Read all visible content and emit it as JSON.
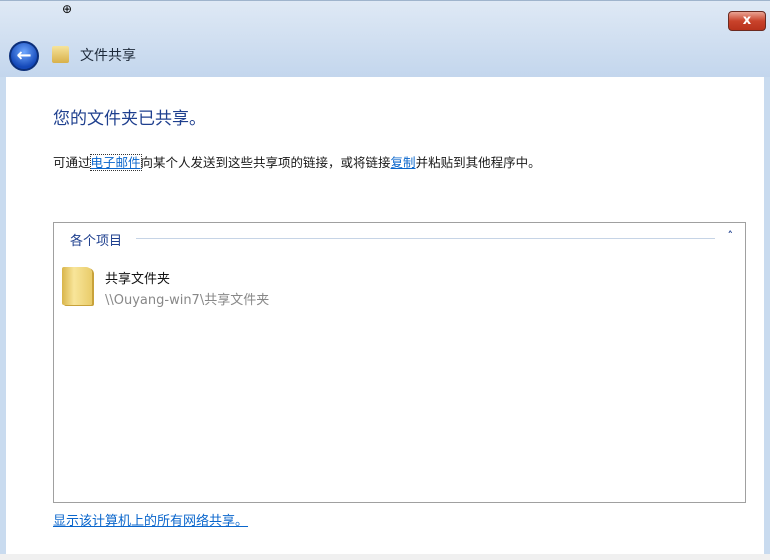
{
  "window": {
    "title": "文件共享",
    "close_label": "x"
  },
  "icons": {
    "back": "back-arrow-icon",
    "zoom": "magnifier-plus-icon",
    "app": "file-sharing-icon",
    "folder": "folder-icon",
    "collapse": "chevron-up-icon"
  },
  "glyphs": {
    "back": "←",
    "zoom": "⊕",
    "app": "♟",
    "collapse": "˄"
  },
  "main": {
    "heading": "您的文件夹已共享。",
    "desc_prefix": "可通过",
    "email_link": "电子邮件",
    "desc_middle": "向某个人发送到这些共享项的链接，或将链接",
    "copy_link": "复制",
    "desc_suffix": "并粘贴到其他程序中。"
  },
  "list": {
    "group_label": "各个项目",
    "items": [
      {
        "name": "共享文件夹",
        "path": "\\\\Ouyang-win7\\共享文件夹"
      }
    ]
  },
  "show_all_link": "显示该计算机上的所有网络共享。"
}
